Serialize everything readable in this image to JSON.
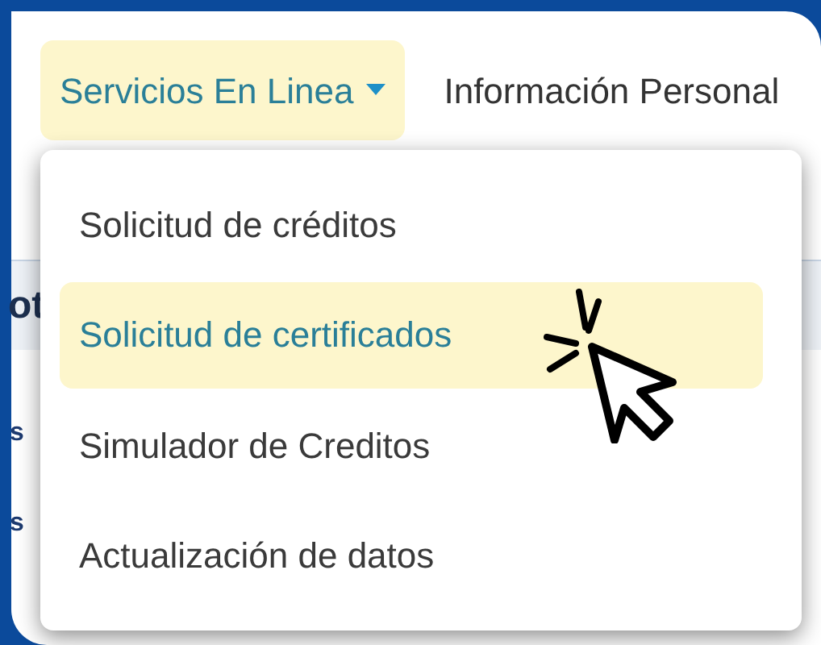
{
  "nav": {
    "items": [
      {
        "label": "Servicios En Linea",
        "selected": true,
        "has_caret": true
      },
      {
        "label": "Información Personal",
        "selected": false,
        "has_caret": false
      }
    ]
  },
  "background": {
    "heading_fragment": "ot",
    "row_fragments": [
      "s",
      "s"
    ]
  },
  "dropdown": {
    "items": [
      {
        "label": "Solicitud de créditos",
        "selected": false
      },
      {
        "label": "Solicitud de certificados",
        "selected": true
      },
      {
        "label": "Simulador de Creditos",
        "selected": false
      },
      {
        "label": "Actualización de datos",
        "selected": false
      }
    ]
  }
}
